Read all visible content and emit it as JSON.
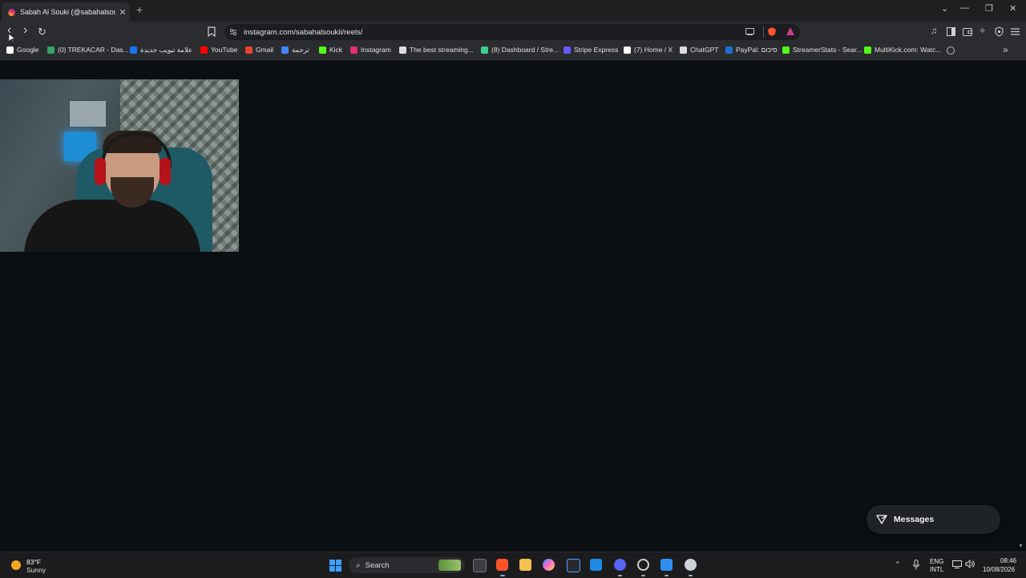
{
  "browser": {
    "tab": {
      "title": "Sabah Al Souki (@sabahalsoukii)",
      "close": "✕"
    },
    "new_tab": "+",
    "window_controls": {
      "dropdown": "⌄",
      "minimize": "—",
      "restore": "❐",
      "close": "✕"
    },
    "nav": {
      "back": "‹",
      "forward": "›",
      "reload": "↻"
    },
    "address": {
      "url": "instagram.com/sabahalsoukii/reels/"
    },
    "bookmarks": [
      {
        "label": "Google",
        "icon": "google-icon",
        "color": "#ffffff"
      },
      {
        "label": "(0) TREKACAR - Das...",
        "icon": "trekacar-icon",
        "color": "#35a36b"
      },
      {
        "label": "علامة تبويب جديدة",
        "icon": "facebook-icon",
        "color": "#1877f2"
      },
      {
        "label": "YouTube",
        "icon": "youtube-icon",
        "color": "#ff0000"
      },
      {
        "label": "Gmail",
        "icon": "gmail-icon",
        "color": "#ea4335"
      },
      {
        "label": "ترجمة",
        "icon": "translate-icon",
        "color": "#4285f4"
      },
      {
        "label": "Kick",
        "icon": "kick-icon",
        "color": "#53fc18"
      },
      {
        "label": "Instagram",
        "icon": "instagram-icon",
        "color": "#e1306c"
      },
      {
        "label": "The best streaming...",
        "icon": "streaming-icon",
        "color": "#dddddd"
      },
      {
        "label": "(8) Dashboard / Stre...",
        "icon": "dashboard-icon",
        "color": "#3ecf8e"
      },
      {
        "label": "Stripe Express",
        "icon": "stripe-icon",
        "color": "#635bff"
      },
      {
        "label": "(7) Home / X",
        "icon": "x-icon",
        "color": "#ffffff"
      },
      {
        "label": "ChatGPT",
        "icon": "chatgpt-icon",
        "color": "#dddddd"
      },
      {
        "label": "PayPal: סיכום",
        "icon": "paypal-icon",
        "color": "#1f6fd1"
      },
      {
        "label": "StreamerStats - Sear...",
        "icon": "streamerstats-icon",
        "color": "#53fc18"
      },
      {
        "label": "MultiKick.com: Watc...",
        "icon": "multikick-icon",
        "color": "#53fc18"
      }
    ],
    "bookmarks_more": "»"
  },
  "page": {
    "messages_label": "Messages"
  },
  "taskbar": {
    "weather": {
      "temp": "83°F",
      "desc": "Sunny"
    },
    "search_label": "Search",
    "tray": {
      "lang_top": "ENG",
      "lang_bottom": "INTL",
      "time": "08:46",
      "date": "10/08/2026",
      "up_arrow": "⌃"
    }
  }
}
